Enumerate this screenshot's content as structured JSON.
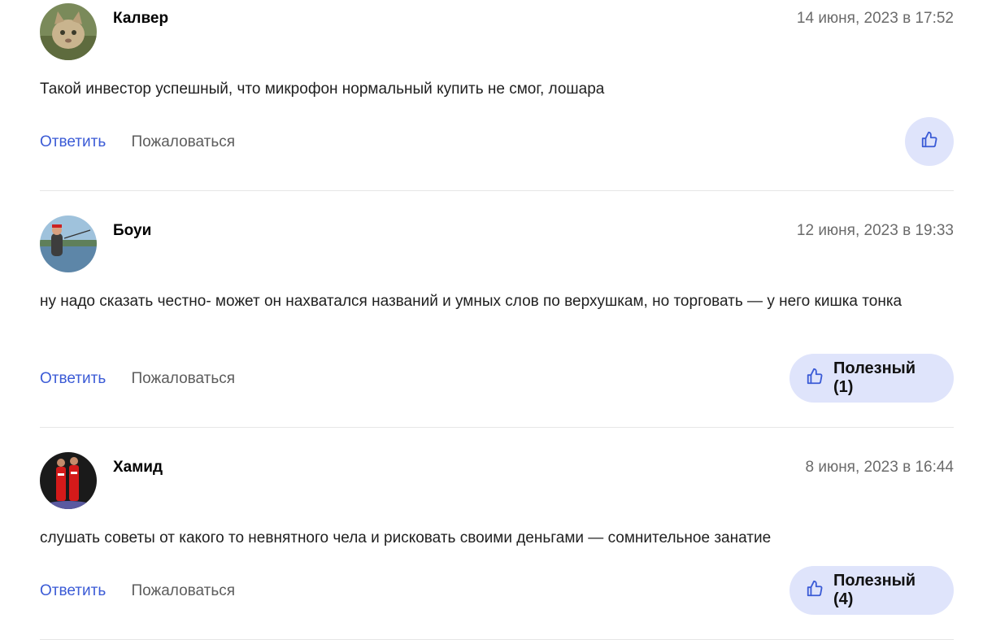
{
  "comments": [
    {
      "author": "Калвер",
      "date": "14 июня, 2023 в 17:52",
      "text": "Такой инвестор успешный, что микрофон нормальный купить не смог, лошара",
      "reply_label": "Ответить",
      "report_label": "Пожаловаться",
      "like_label": ""
    },
    {
      "author": "Боуи",
      "date": "12 июня, 2023 в 19:33",
      "text": "ну надо сказать честно- может он нахватался названий и умных слов по верхушкам, но торговать — у него кишка тонка",
      "reply_label": "Ответить",
      "report_label": "Пожаловаться",
      "like_label": "Полезный (1)"
    },
    {
      "author": "Хамид",
      "date": "8 июня, 2023 в 16:44",
      "text": "слушать советы от какого то невнятного чела и рисковать своими деньгами — сомнительное занатие",
      "reply_label": "Ответить",
      "report_label": "Пожаловаться",
      "like_label": "Полезный (4)"
    }
  ],
  "colors": {
    "accent": "#3b5bd6",
    "like_bg": "#dfe4fb",
    "date": "#6b6b6b"
  },
  "icons": {
    "like": "thumbs-up-icon"
  }
}
